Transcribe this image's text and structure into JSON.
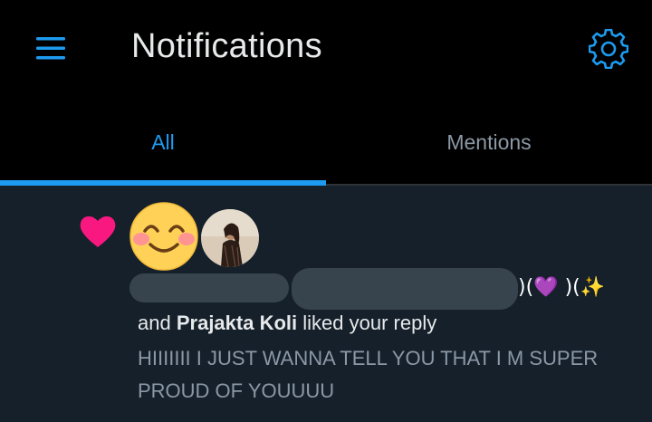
{
  "header": {
    "title": "Notifications",
    "menu_icon": "hamburger-menu-icon",
    "settings_icon": "gear-icon"
  },
  "tabs": [
    {
      "label": "All",
      "active": true
    },
    {
      "label": "Mentions",
      "active": false
    }
  ],
  "notification": {
    "type_icon": "heart-icon",
    "avatars": [
      "smiling-face-emoji-avatar",
      "profile-photo-avatar"
    ],
    "name_suffix_glyphs": ")(",
    "name_suffix_heart": "💜",
    "name_suffix_close": ")(",
    "name_suffix_sparkle": "✨",
    "prefix": "and",
    "user_name": "Prajakta Koli",
    "action": "liked your reply",
    "quoted_text": "HIIIIIII I JUST WANNA TELL YOU THAT I M SUPER PROUD OF YOUUUU"
  },
  "colors": {
    "accent": "#1d9bf0",
    "like": "#f91880",
    "feed_background": "#15202b",
    "header_background": "#000000",
    "muted_text": "#8b98a5"
  }
}
